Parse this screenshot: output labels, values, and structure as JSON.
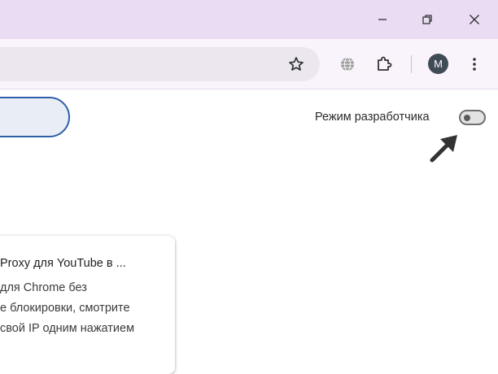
{
  "window": {
    "minimize_icon": "minimize-icon",
    "restore_icon": "restore-icon",
    "close_icon": "close-icon"
  },
  "toolbar": {
    "bookmark_icon": "star-icon",
    "globe_icon": "globe-icon",
    "extensions_icon": "puzzle-icon",
    "profile_initial": "M",
    "menu_icon": "kebab-menu-icon"
  },
  "developer_mode": {
    "label": "Режим разработчика",
    "enabled": false
  },
  "extension_card": {
    "title": "Proxy для YouTube в ...",
    "description_lines": [
      "для Chrome без",
      "е блокировки, смотрите",
      "свой IP одним нажатием"
    ]
  },
  "colors": {
    "titlebar": "#e9dcf3",
    "toolbar": "#f9f3fc",
    "search_border": "#2f5fa9",
    "avatar": "#3f4b55"
  }
}
